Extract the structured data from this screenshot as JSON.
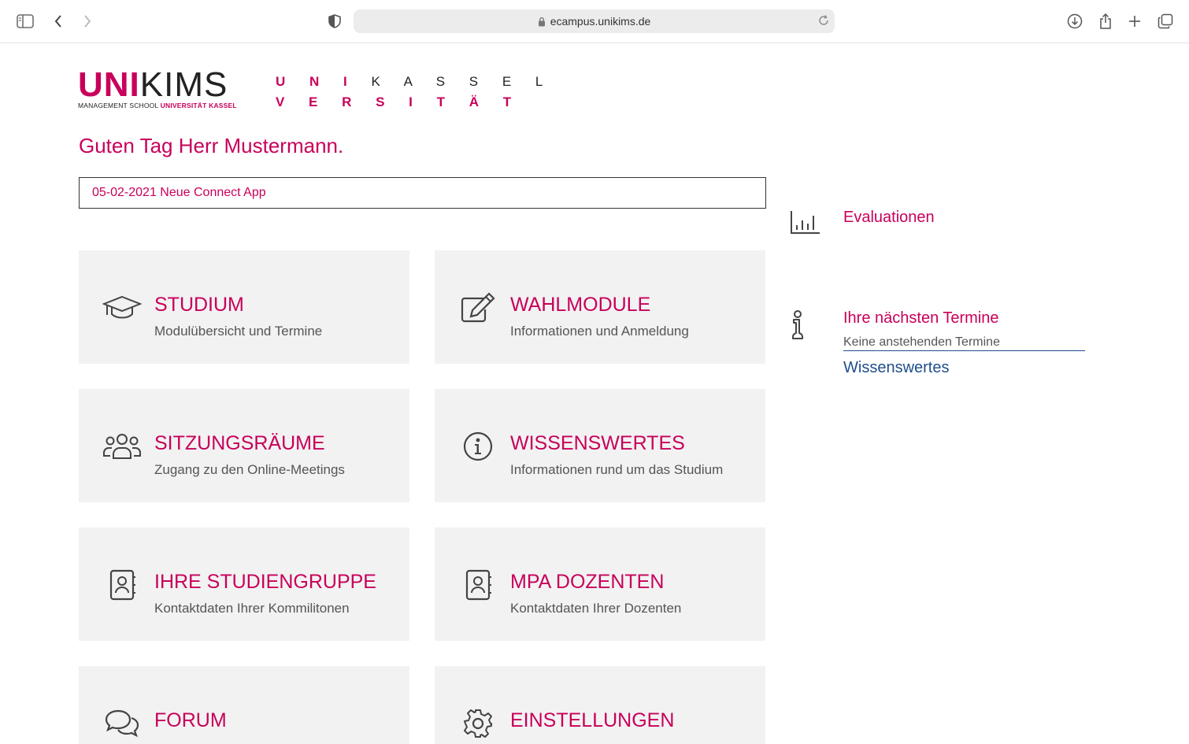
{
  "browser": {
    "url": "ecampus.unikims.de"
  },
  "logos": {
    "unikims_uni": "UNI",
    "unikims_kims": "KIMS",
    "unikims_sub_black": "MANAGEMENT SCHOOL ",
    "unikims_sub_red": "UNIVERSITÄT KASSEL",
    "kassel_row1_a": "U N I",
    "kassel_row1_b": "K A S S E L",
    "kassel_row2": "V E R S I T Ä T"
  },
  "greeting": "Guten Tag Herr Mustermann.",
  "news": "05-02-2021 Neue Connect App",
  "tiles": [
    {
      "title": "STUDIUM",
      "desc": "Modulübersicht und Termine",
      "icon": "graduation-cap-icon"
    },
    {
      "title": "WAHLMODULE",
      "desc": "Informationen und Anmeldung",
      "icon": "edit-icon"
    },
    {
      "title": "SITZUNGSRÄUME",
      "desc": "Zugang zu den Online-Meetings",
      "icon": "users-icon"
    },
    {
      "title": "WISSENSWERTES",
      "desc": "Informationen rund um das Studium",
      "icon": "info-icon"
    },
    {
      "title": "IHRE STUDIENGRUPPE",
      "desc": "Kontaktdaten Ihrer Kommilitonen",
      "icon": "contacts-icon"
    },
    {
      "title": "MPA DOZENTEN",
      "desc": "Kontaktdaten Ihrer Dozenten",
      "icon": "contacts-icon"
    },
    {
      "title": "FORUM",
      "desc": "",
      "icon": "chat-icon"
    },
    {
      "title": "EINSTELLUNGEN",
      "desc": "",
      "icon": "gear-icon"
    }
  ],
  "sidebar": {
    "evaluationen": "Evaluationen",
    "termine_title": "Ihre nächsten Termine",
    "termine_empty": "Keine anstehenden Termine",
    "wissenswertes": "Wissenswertes"
  },
  "colors": {
    "brand": "#c8005a",
    "link": "#1f4e8c",
    "tile_bg": "#f2f2f2"
  }
}
